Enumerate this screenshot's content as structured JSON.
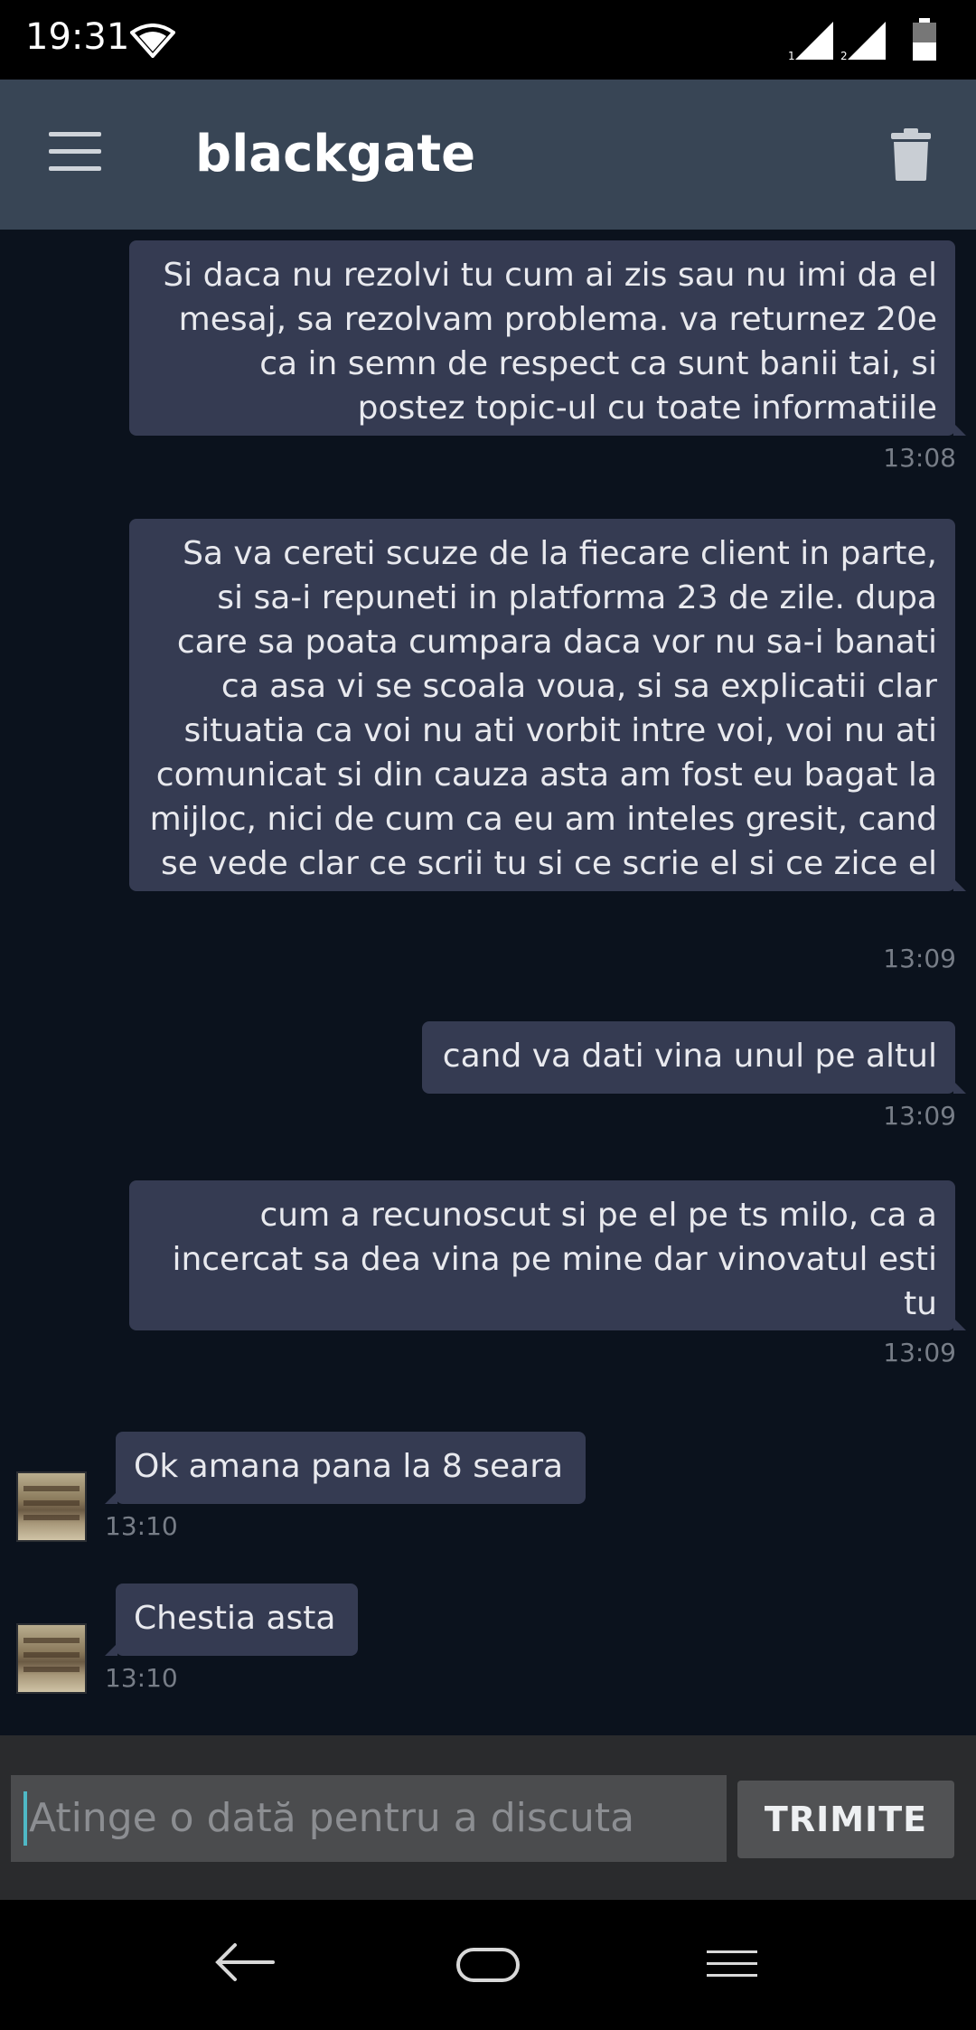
{
  "status_bar": {
    "time": "19:31",
    "sim1": "1",
    "sim2": "2",
    "icons": [
      "wifi-icon",
      "signal-sim1-icon",
      "signal-sim2-icon",
      "battery-icon"
    ]
  },
  "app_bar": {
    "title": "blackgate",
    "menu_icon": "menu-icon",
    "delete_icon": "trash-icon"
  },
  "messages": [
    {
      "direction": "outgoing",
      "text": "Si daca nu rezolvi tu cum ai zis sau nu imi da el mesaj, sa rezolvam problema. va returnez 20e ca in semn de respect ca sunt banii tai, si postez topic-ul cu toate informatiile",
      "time": "13:08"
    },
    {
      "direction": "outgoing",
      "text": "Sa va cereti scuze de la fiecare client in parte, si sa-i repuneti in platforma 23 de zile. dupa care sa poata cumpara daca vor nu sa-i banati ca asa vi se scoala voua, si sa explicatii clar situatia ca voi nu ati vorbit intre voi, voi nu ati comunicat si din cauza asta am fost eu bagat la mijloc, nici de cum ca eu am inteles gresit, cand se vede clar ce scrii tu si ce scrie el si ce zice el",
      "time": "13:09"
    },
    {
      "direction": "outgoing",
      "text": "cand va dati vina unul pe altul",
      "time": "13:09"
    },
    {
      "direction": "outgoing",
      "text": "cum a recunoscut si pe el pe ts milo, ca a incercat sa dea vina pe mine dar vinovatul esti tu",
      "time": "13:09"
    },
    {
      "direction": "incoming",
      "text": "Ok amana pana la 8 seara",
      "time": "13:10"
    },
    {
      "direction": "incoming",
      "text": "Chestia asta",
      "time": "13:10"
    }
  ],
  "composer": {
    "placeholder": "Atinge o dată pentru a discuta",
    "send_label": "TRIMITE"
  },
  "nav_bar": {
    "icons": [
      "back-icon",
      "home-icon",
      "recent-apps-icon"
    ]
  },
  "colors": {
    "background": "#0b121d",
    "app_bar": "#384555",
    "bubble": "#353b52",
    "accent_caret": "#4fb8c5"
  }
}
